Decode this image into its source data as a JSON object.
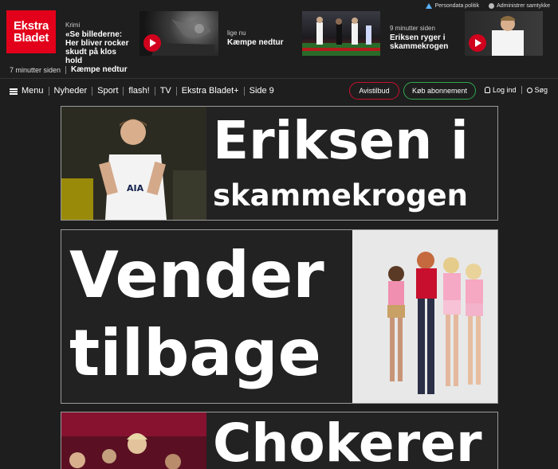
{
  "util": {
    "privacy": "Persondata politik",
    "consent": "Administrer samtykke"
  },
  "logo": {
    "line1": "Ekstra",
    "line2": "Bladet"
  },
  "teasers": [
    {
      "kicker": "Krimi",
      "headline": "«Se billederne: Her bliver rocker skudt på klos hold"
    },
    {
      "kicker": "lige nu",
      "headline": "Kæmpe nedtur"
    },
    {
      "kicker": "9 minutter siden",
      "headline": "Eriksen ryger i skammekrogen"
    }
  ],
  "breaking": {
    "time": "7 minutter siden",
    "title": "Kæmpe nedtur"
  },
  "nav": {
    "menu": "Menu",
    "items": [
      "Nyheder",
      "Sport",
      "flash!",
      "TV",
      "Ekstra Bladet+",
      "Side 9"
    ],
    "avistilbud": "Avistilbud",
    "subscribe": "Køb abonnement",
    "login": "Log ind",
    "search": "Søg"
  },
  "articles": [
    {
      "line1": "Eriksen i",
      "line2": "skammekrogen"
    },
    {
      "line1": "Vender",
      "line2": "tilbage"
    },
    {
      "line1": "Chokerer i"
    }
  ],
  "colors": {
    "brand": "#e2001a",
    "bg": "#1e1e1e",
    "subscribe": "#2fa84f"
  }
}
